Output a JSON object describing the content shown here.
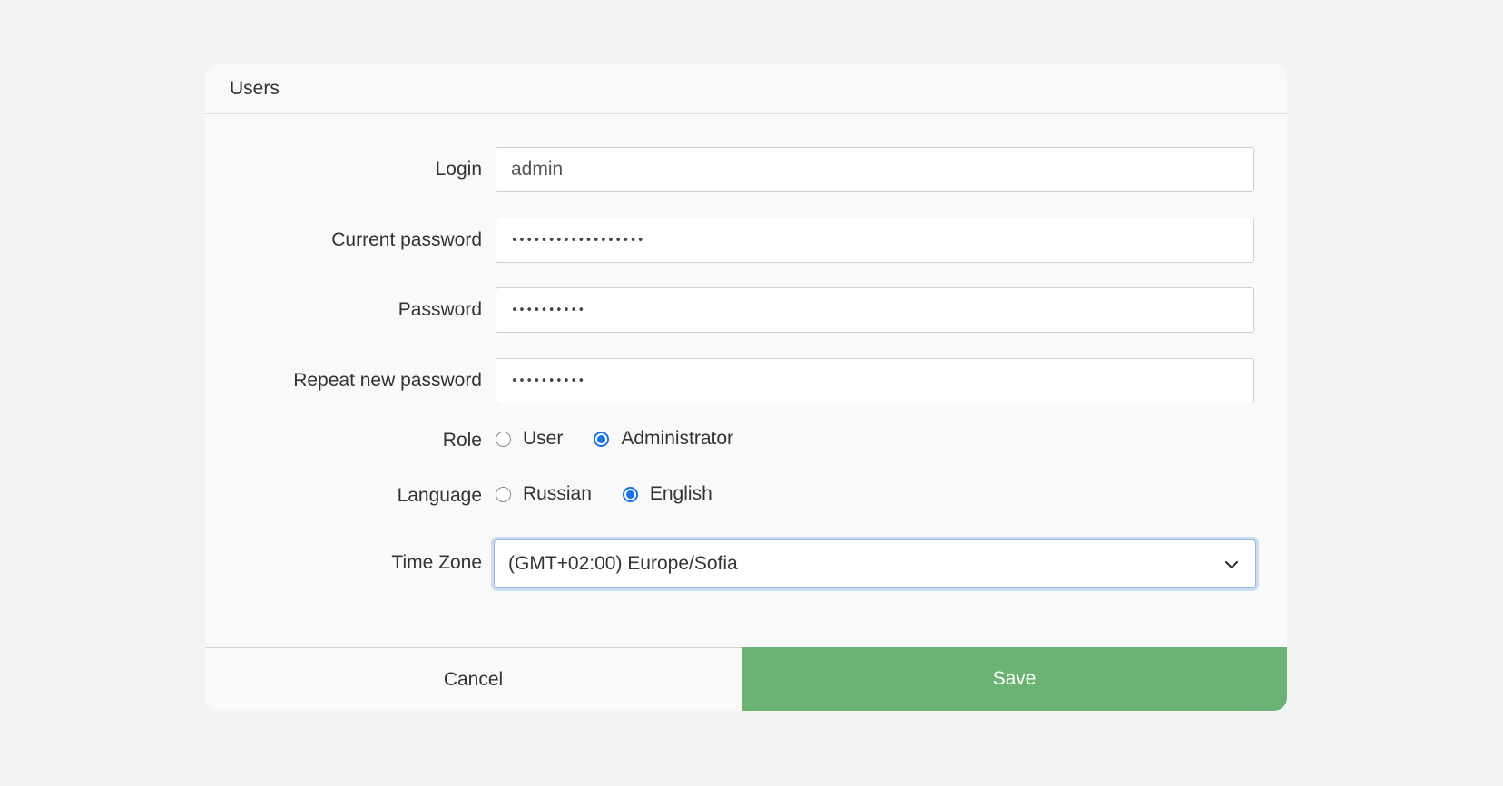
{
  "dialog": {
    "title": "Users"
  },
  "form": {
    "login": {
      "label": "Login",
      "value": "admin"
    },
    "current_password": {
      "label": "Current password",
      "value": "••••••••••••••••••"
    },
    "password": {
      "label": "Password",
      "value": "••••••••••"
    },
    "repeat_password": {
      "label": "Repeat new password",
      "value": "••••••••••"
    },
    "role": {
      "label": "Role",
      "options": [
        {
          "label": "User",
          "checked": false
        },
        {
          "label": "Administrator",
          "checked": true
        }
      ]
    },
    "language": {
      "label": "Language",
      "options": [
        {
          "label": "Russian",
          "checked": false
        },
        {
          "label": "English",
          "checked": true
        }
      ]
    },
    "timezone": {
      "label": "Time Zone",
      "value": "(GMT+02:00) Europe/Sofia"
    }
  },
  "footer": {
    "cancel_label": "Cancel",
    "save_label": "Save"
  },
  "colors": {
    "accent": "#1a73e8",
    "save": "#6bb373"
  },
  "icons": {
    "timezone_dropdown": "chevron-down-icon"
  }
}
